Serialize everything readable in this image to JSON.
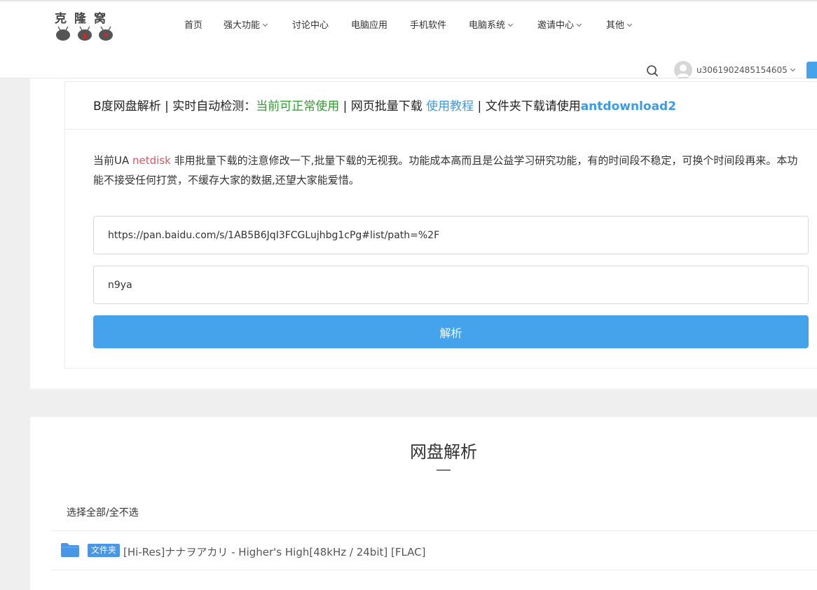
{
  "header": {
    "logo_text": "克隆窝",
    "nav": [
      {
        "label": "首页",
        "has_dropdown": false
      },
      {
        "label": "强大功能",
        "has_dropdown": true
      },
      {
        "label": "讨论中心",
        "has_dropdown": false
      },
      {
        "label": "电脑应用",
        "has_dropdown": false
      },
      {
        "label": "手机软件",
        "has_dropdown": false
      },
      {
        "label": "电脑系统",
        "has_dropdown": true
      },
      {
        "label": "邀请中心",
        "has_dropdown": true
      },
      {
        "label": "其他",
        "has_dropdown": true
      }
    ],
    "username": "u3061902485154605",
    "icons": {
      "search": "search-icon",
      "avatar": "user-avatar-icon",
      "dropdown": "chevron-down-icon"
    }
  },
  "parser": {
    "heading_prefix": "B度网盘解析 | 实时自动检测：",
    "status_text": "当前可正常使用",
    "heading_mid": " | 网页批量下载 ",
    "tutorial_link": "使用教程",
    "heading_mid2": " | 文件夹下载请使用",
    "antdownload_link": "antdownload2",
    "notice_prefix": "当前UA ",
    "notice_ua": "netdisk",
    "notice_rest": " 非用批量下载的注意修改一下,批量下载的无视我。功能成本高而且是公益学习研究功能，有的时间段不稳定，可换个时间段再来。本功能不接受任何打赏，不缓存大家的数据,还望大家能爱惜。",
    "url_value": "https://pan.baidu.com/s/1AB5B6JqI3FCGLujhbg1cPg#list/path=%2F",
    "code_value": "n9ya",
    "parse_button": "解析"
  },
  "results": {
    "title": "网盘解析",
    "select_all": "选择全部/全不选",
    "files": [
      {
        "badge": "文件夹",
        "name": "[Hi-Res]ナナヲアカリ - Higher's High[48kHz / 24bit] [FLAC]",
        "icon": "folder-icon"
      }
    ]
  },
  "colors": {
    "accent": "#45a3ec",
    "status_green": "#2ea02e",
    "link_blue": "#3d9be5",
    "ua_red": "#e0555a",
    "badge_blue": "#4a96e6"
  }
}
